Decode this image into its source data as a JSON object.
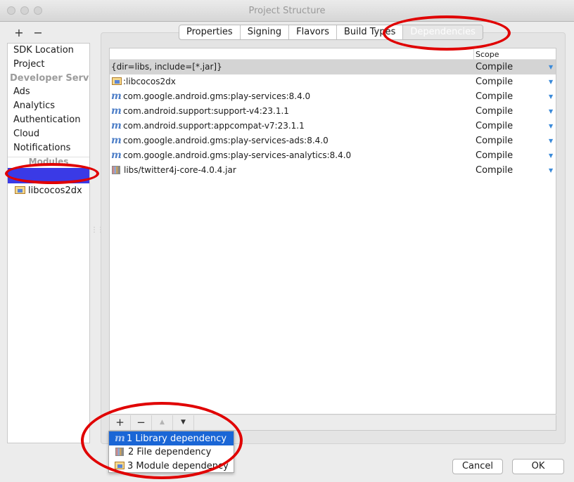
{
  "window": {
    "title": "Project Structure"
  },
  "sidebar": {
    "add_label": "+",
    "remove_label": "−",
    "items": [
      {
        "label": "SDK Location",
        "kind": "item"
      },
      {
        "label": "Project",
        "kind": "item"
      },
      {
        "label": "Developer Services",
        "kind": "header"
      },
      {
        "label": "Ads",
        "kind": "item"
      },
      {
        "label": "Analytics",
        "kind": "item"
      },
      {
        "label": "Authentication",
        "kind": "item"
      },
      {
        "label": "Cloud",
        "kind": "item"
      },
      {
        "label": "Notifications",
        "kind": "item"
      }
    ],
    "modules_header": "Modules",
    "modules": [
      {
        "label": "libcocos2dx"
      }
    ]
  },
  "tabs": [
    {
      "label": "Properties"
    },
    {
      "label": "Signing"
    },
    {
      "label": "Flavors"
    },
    {
      "label": "Build Types"
    },
    {
      "label": "Dependencies",
      "active": true
    }
  ],
  "table": {
    "scope_header": "Scope",
    "rows": [
      {
        "icon": "none",
        "name": "{dir=libs, include=[*.jar]}",
        "scope": "Compile",
        "selected": true
      },
      {
        "icon": "module-folder-icon",
        "name": ":libcocos2dx",
        "scope": "Compile"
      },
      {
        "icon": "maven-icon",
        "name": "com.google.android.gms:play-services:8.4.0",
        "scope": "Compile"
      },
      {
        "icon": "maven-icon",
        "name": "com.android.support:support-v4:23.1.1",
        "scope": "Compile"
      },
      {
        "icon": "maven-icon",
        "name": "com.android.support:appcompat-v7:23.1.1",
        "scope": "Compile"
      },
      {
        "icon": "maven-icon",
        "name": "com.google.android.gms:play-services-ads:8.4.0",
        "scope": "Compile"
      },
      {
        "icon": "maven-icon",
        "name": "com.google.android.gms:play-services-analytics:8.4.0",
        "scope": "Compile"
      },
      {
        "icon": "jar-icon",
        "name": "libs/twitter4j-core-4.0.4.jar",
        "scope": "Compile"
      }
    ]
  },
  "toolbar": {
    "add_label": "+",
    "remove_label": "−",
    "up_label": "▲",
    "down_label": "▼"
  },
  "popup": {
    "items": [
      {
        "icon": "maven-icon",
        "label": "1  Library dependency",
        "highlighted": true
      },
      {
        "icon": "jar-icon",
        "label": "2  File dependency"
      },
      {
        "icon": "module-folder-icon",
        "label": "3  Module dependency"
      }
    ]
  },
  "buttons": {
    "cancel": "Cancel",
    "ok": "OK"
  },
  "colors": {
    "annotation": "#e00000",
    "redaction": "#3a3ae6",
    "selection": "#1a66d6"
  }
}
